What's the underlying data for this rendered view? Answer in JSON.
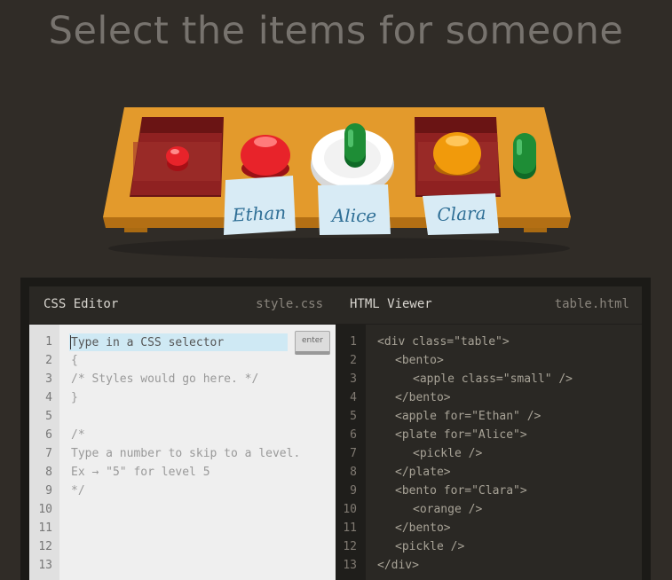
{
  "title": "Select the items for someone",
  "table": {
    "name_tags": [
      "Ethan",
      "Alice",
      "Clara"
    ]
  },
  "css_editor": {
    "title": "CSS Editor",
    "filename": "style.css",
    "input_placeholder": "Type in a CSS selector",
    "enter_label": "enter",
    "line_numbers": [
      "1",
      "2",
      "3",
      "4",
      "5",
      "6",
      "7",
      "8",
      "9",
      "10",
      "11",
      "12",
      "13"
    ],
    "lines": [
      "{",
      "/* Styles would go here. */",
      "}",
      "",
      "/*",
      "Type a number to skip to a level.",
      "Ex → \"5\" for level 5",
      "*/"
    ]
  },
  "html_viewer": {
    "title": "HTML Viewer",
    "filename": "table.html",
    "line_numbers": [
      "1",
      "2",
      "3",
      "4",
      "5",
      "6",
      "7",
      "8",
      "9",
      "10",
      "11",
      "12",
      "13"
    ],
    "lines": [
      {
        "indent": 0,
        "text": "<div class=\"table\">"
      },
      {
        "indent": 1,
        "text": "<bento>"
      },
      {
        "indent": 2,
        "text": "<apple class=\"small\" />"
      },
      {
        "indent": 1,
        "text": "</bento>"
      },
      {
        "indent": 1,
        "text": "<apple for=\"Ethan\" />"
      },
      {
        "indent": 1,
        "text": "<plate for=\"Alice\">"
      },
      {
        "indent": 2,
        "text": "<pickle />"
      },
      {
        "indent": 1,
        "text": "</plate>"
      },
      {
        "indent": 1,
        "text": "<bento for=\"Clara\">"
      },
      {
        "indent": 2,
        "text": "<orange />"
      },
      {
        "indent": 1,
        "text": "</bento>"
      },
      {
        "indent": 1,
        "text": "<pickle />"
      },
      {
        "indent": 0,
        "text": "</div>"
      }
    ]
  },
  "colors": {
    "background": "#302c27",
    "table": "#e39a2c",
    "bento": "#8f2121",
    "apple": "#e8232a",
    "pickle": "#1e8d36",
    "orange": "#f19a0b",
    "note": "#d8ebf5"
  }
}
